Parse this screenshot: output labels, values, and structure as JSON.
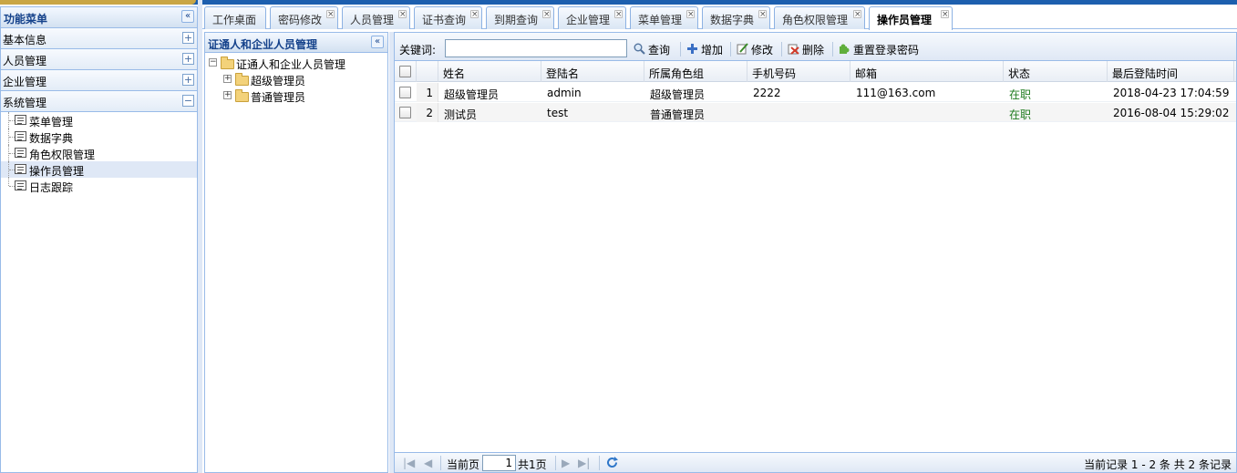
{
  "sidebar": {
    "title": "功能菜单",
    "collapse_glyph": "«",
    "sections": [
      {
        "label": "基本信息",
        "toggle": "+"
      },
      {
        "label": "人员管理",
        "toggle": "+"
      },
      {
        "label": "企业管理",
        "toggle": "+"
      },
      {
        "label": "系统管理",
        "toggle": "−"
      }
    ],
    "items": [
      {
        "label": "菜单管理"
      },
      {
        "label": "数据字典"
      },
      {
        "label": "角色权限管理"
      },
      {
        "label": "操作员管理",
        "selected": true
      },
      {
        "label": "日志跟踪"
      }
    ]
  },
  "tabs": [
    {
      "label": "工作桌面"
    },
    {
      "label": "密码修改"
    },
    {
      "label": "人员管理"
    },
    {
      "label": "证书查询"
    },
    {
      "label": "到期查询"
    },
    {
      "label": "企业管理"
    },
    {
      "label": "菜单管理"
    },
    {
      "label": "数据字典"
    },
    {
      "label": "角色权限管理"
    },
    {
      "label": "操作员管理",
      "active": true
    }
  ],
  "tab_close_glyph": "×",
  "tree": {
    "title": "证通人和企业人员管理",
    "collapse_glyph": "«",
    "root": "证通人和企业人员管理",
    "children": [
      "超级管理员",
      "普通管理员"
    ]
  },
  "toolbar": {
    "keyword_label": "关键词:",
    "keyword_value": "",
    "search_label": "查询",
    "add_label": "增加",
    "edit_label": "修改",
    "delete_label": "删除",
    "reset_label": "重置登录密码"
  },
  "table": {
    "columns": [
      "姓名",
      "登陆名",
      "所属角色组",
      "手机号码",
      "邮箱",
      "状态",
      "最后登陆时间"
    ],
    "rows": [
      {
        "num": "1",
        "name": "超级管理员",
        "login": "admin",
        "role": "超级管理员",
        "phone": "2222",
        "email": "111@163.com",
        "status": "在职",
        "last_login": "2018-04-23 17:04:59"
      },
      {
        "num": "2",
        "name": "测试员",
        "login": "test",
        "role": "普通管理员",
        "phone": "",
        "email": "",
        "status": "在职",
        "last_login": "2016-08-04 15:29:02"
      }
    ]
  },
  "pager": {
    "current_label": "当前页",
    "page_value": "1",
    "total_label": "共1页",
    "summary": "当前记录 1 - 2 条 共 2 条记录"
  },
  "colors": {
    "accent": "#15428b",
    "border": "#99bbe8",
    "status_active": "#1e7b1e"
  }
}
